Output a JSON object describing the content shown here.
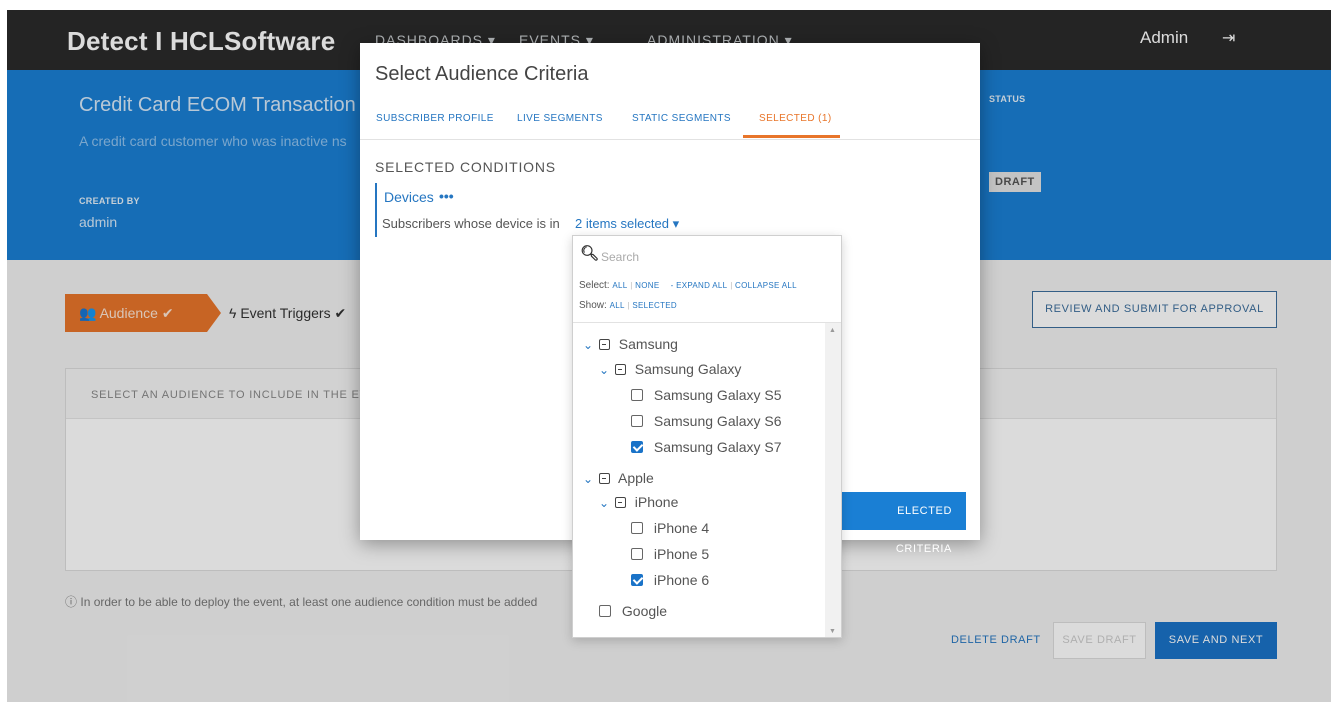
{
  "app": {
    "brand": "Detect I HCLSoftware",
    "nav": [
      "DASHBOARDS",
      "EVENTS",
      "ADMINISTRATION"
    ],
    "admin_label": "Admin",
    "logout_icon": "sign-out-icon"
  },
  "event": {
    "title": "Credit Card ECOM Transaction",
    "description": "A credit card customer who was inactive ns",
    "created_by_label": "CREATED BY",
    "created_by": "admin",
    "status_label": "STATUS",
    "status": "DRAFT"
  },
  "steps": {
    "audience": "Audience",
    "event_triggers": "Event Triggers"
  },
  "actions": {
    "review": "REVIEW AND SUBMIT FOR APPROVAL",
    "delete_draft": "DELETE DRAFT",
    "save_draft": "SAVE DRAFT",
    "save_next": "SAVE AND NEXT"
  },
  "panel": {
    "header": "SELECT AN AUDIENCE TO INCLUDE IN THE EVE",
    "note": "In order to be able to deploy the event, at least one audience condition must be added"
  },
  "modal": {
    "title": "Select Audience Criteria",
    "tabs": [
      "SUBSCRIBER PROFILE",
      "LIVE SEGMENTS",
      "STATIC SEGMENTS",
      "SELECTED (1)"
    ],
    "selected_title": "SELECTED CONDITIONS",
    "condition_name": "Devices",
    "condition_dots": "•••",
    "condition_text": "Subscribers whose device is in",
    "condition_link": "2 items selected",
    "apply_label": "ELECTED CRITERIA"
  },
  "dropdown": {
    "search_placeholder": "Search",
    "select_label": "Select:",
    "all": "ALL",
    "none": "NONE",
    "expand_all": "- EXPAND ALL",
    "collapse_all": "COLLAPSE ALL",
    "show_label": "Show:",
    "show_all": "ALL",
    "show_selected": "SELECTED",
    "tree": [
      {
        "label": "Samsung"
      },
      {
        "label": "Samsung Galaxy"
      },
      {
        "label": "Samsung Galaxy S5",
        "checked": false
      },
      {
        "label": "Samsung Galaxy S6",
        "checked": false
      },
      {
        "label": "Samsung Galaxy S7",
        "checked": true
      },
      {
        "label": "Apple"
      },
      {
        "label": "iPhone"
      },
      {
        "label": "iPhone 4",
        "checked": false
      },
      {
        "label": "iPhone 5",
        "checked": false
      },
      {
        "label": "iPhone 6",
        "checked": true
      },
      {
        "label": "Google",
        "checked": false
      }
    ]
  },
  "colors": {
    "nav_bg": "#2b2b2b",
    "header_blue": "#1a7fd4",
    "accent_orange": "#e8752a",
    "link_blue": "#2576c1"
  }
}
